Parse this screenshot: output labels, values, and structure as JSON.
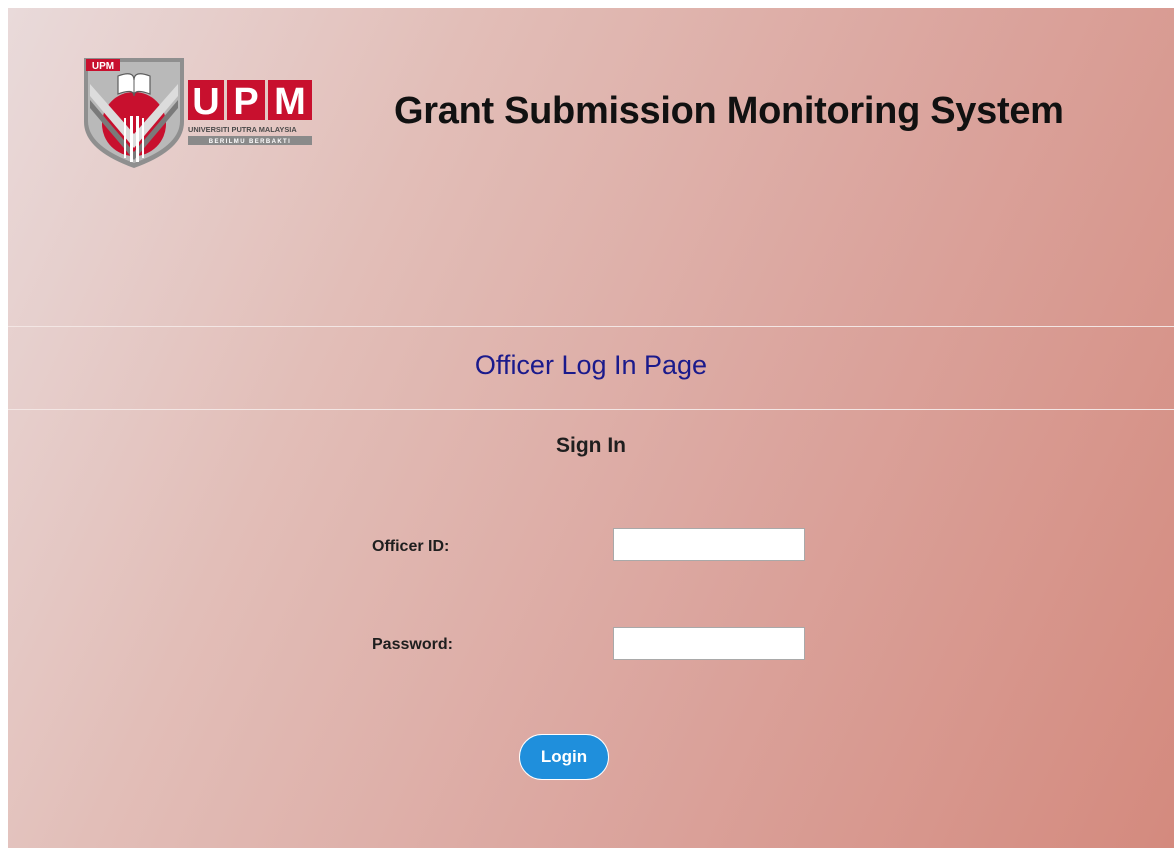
{
  "header": {
    "logo": {
      "badge_text": "UPM",
      "wordmark": "UPM",
      "university_name": "UNIVERSITI PUTRA MALAYSIA",
      "motto": "BERILMU BERBAKTI",
      "colors": {
        "crimson": "#c8102e",
        "gray": "#8a8a8a",
        "dark_gray": "#5c5c5c"
      }
    },
    "title": "Grant Submission Monitoring System"
  },
  "page_heading": "Officer Log In Page",
  "sign_in": {
    "heading": "Sign In",
    "officer_id": {
      "label": "Officer ID:",
      "value": ""
    },
    "password": {
      "label": "Password:",
      "value": ""
    },
    "login_button": "Login"
  },
  "colors": {
    "page_heading": "#1a1a8c",
    "login_button_bg": "#1f8fdc",
    "background_start": "#e9dada",
    "background_end": "#d48a7e"
  }
}
